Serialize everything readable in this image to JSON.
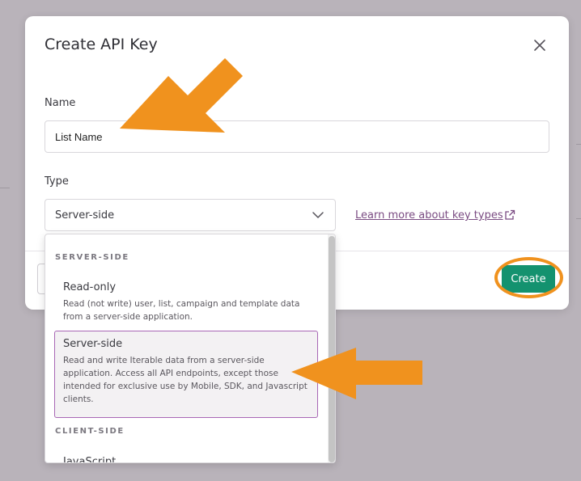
{
  "modal": {
    "title": "Create API Key",
    "name_label": "Name",
    "name_value": "List Name",
    "type_label": "Type",
    "type_value": "Server-side",
    "learn_more": "Learn more about key types",
    "create_label": "Create"
  },
  "dropdown": {
    "groups": [
      {
        "label": "SERVER-SIDE",
        "options": [
          {
            "title": "Read-only",
            "description": "Read (not write) user, list, campaign and template data from a server-side application.",
            "selected": false
          },
          {
            "title": "Server-side",
            "description": "Read and write Iterable data from a server-side application. Access all API endpoints, except those intended for exclusive use by Mobile, SDK, and Javascript clients.",
            "selected": true
          }
        ]
      },
      {
        "label": "CLIENT-SIDE",
        "options": [
          {
            "title": "JavaScript",
            "selected": false
          }
        ]
      }
    ]
  },
  "colors": {
    "create_button": "#14926f",
    "link": "#7a4b82",
    "selected_border": "#a867b5",
    "annotation_arrow": "#f0921e"
  }
}
